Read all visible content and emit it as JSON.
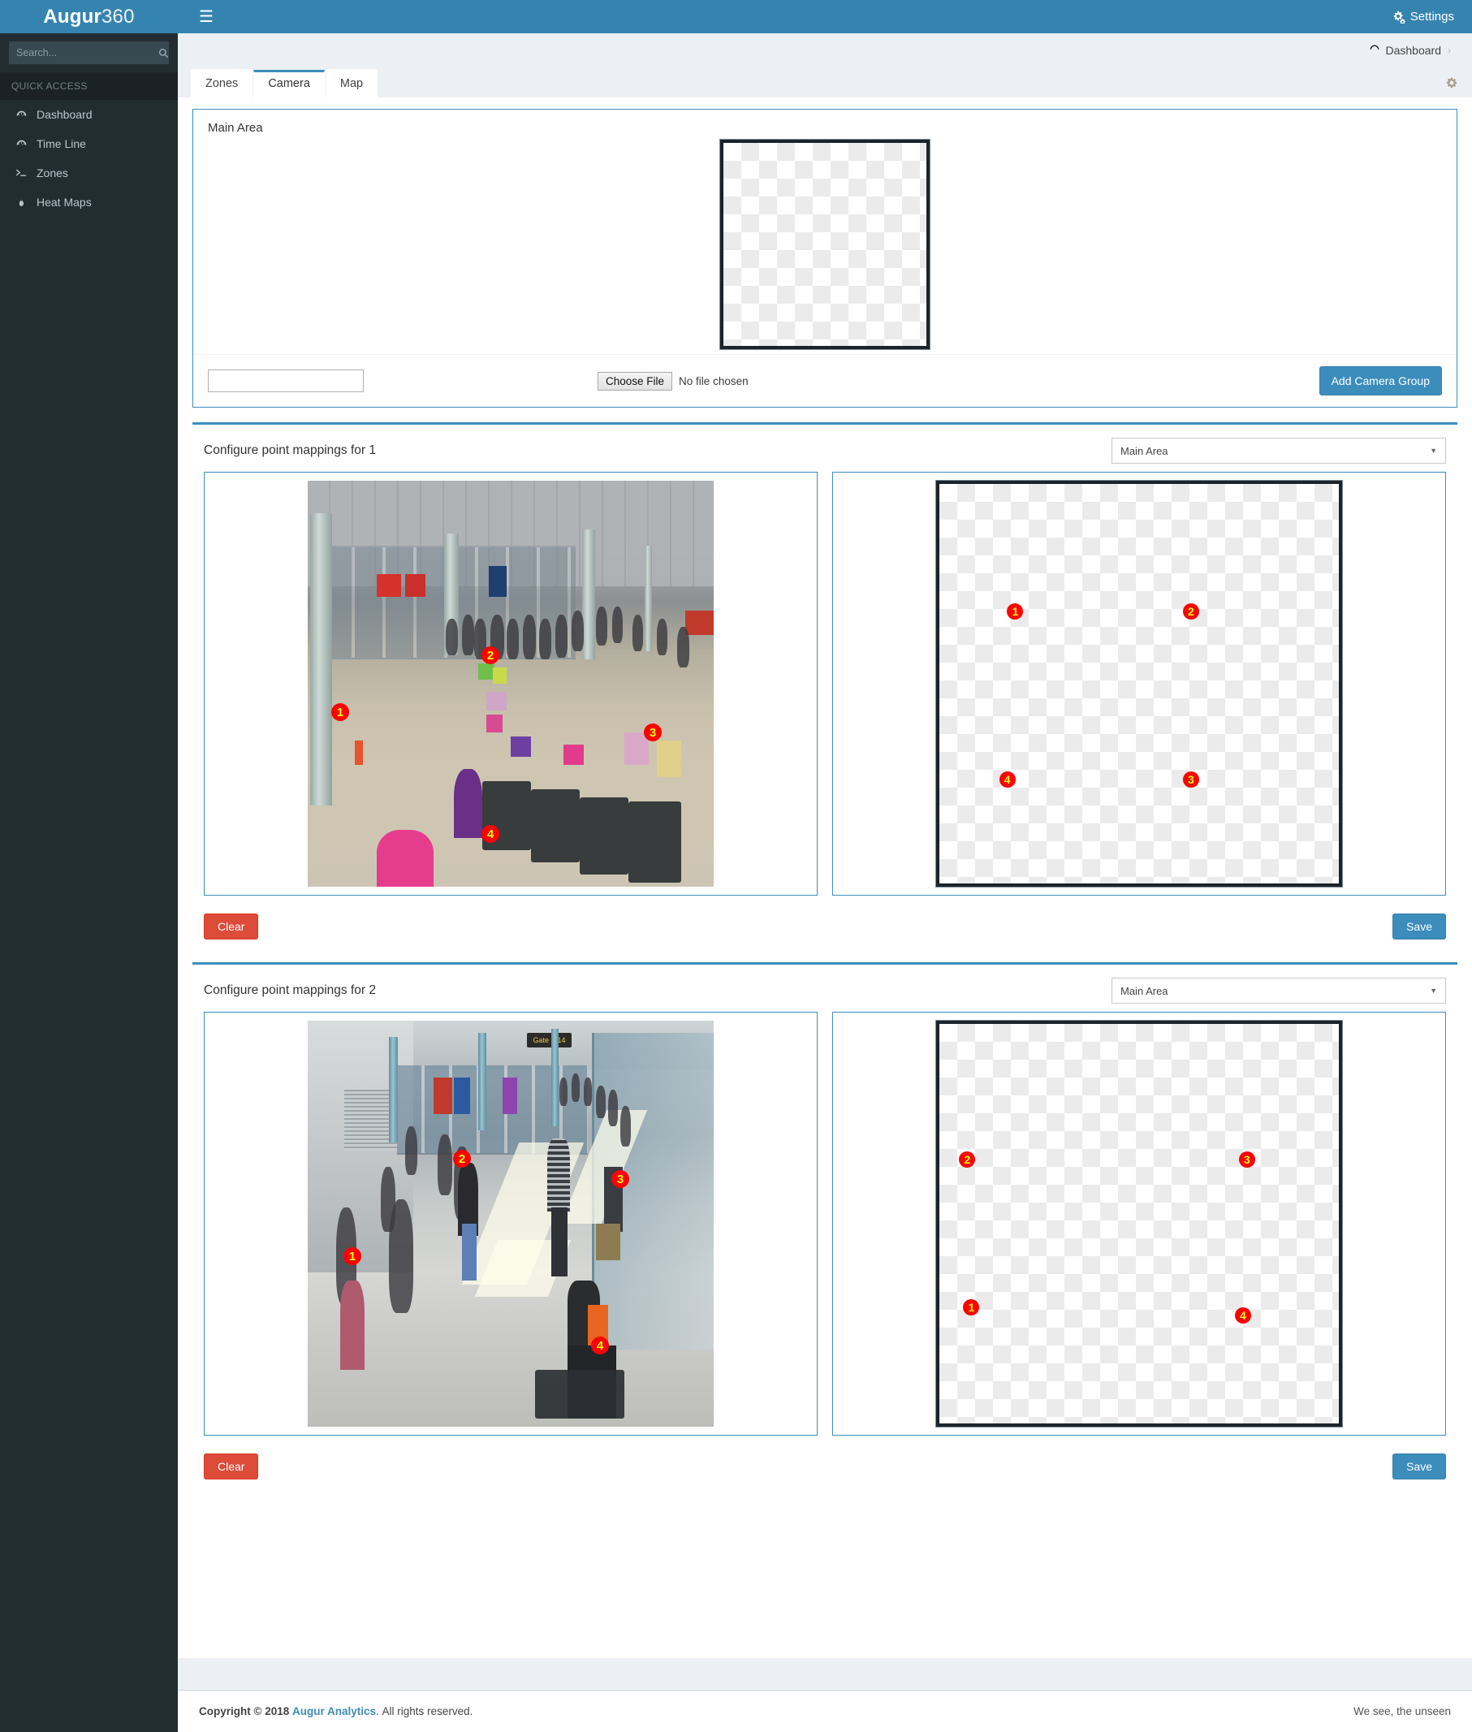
{
  "header": {
    "brand_bold": "Augur",
    "brand_light": "360",
    "menu_icon": "hamburger-icon",
    "settings_label": "Settings",
    "settings_icon": "gears-icon"
  },
  "sidebar": {
    "search_placeholder": "Search...",
    "search_value": "",
    "search_icon": "search-icon",
    "section_label": "QUICK ACCESS",
    "items": [
      {
        "label": "Dashboard",
        "icon": "dashboard-icon"
      },
      {
        "label": "Time Line",
        "icon": "timeline-icon"
      },
      {
        "label": "Zones",
        "icon": "terminal-icon"
      },
      {
        "label": "Heat Maps",
        "icon": "fire-icon"
      }
    ]
  },
  "breadcrumb": {
    "icon": "dashboard-icon",
    "label": "Dashboard",
    "separator": "›"
  },
  "tabs": [
    {
      "label": "Zones",
      "active": false
    },
    {
      "label": "Camera",
      "active": true
    },
    {
      "label": "Map",
      "active": false
    }
  ],
  "tabbar_gear_icon": "gear-icon",
  "camera_group_panel": {
    "title": "Main Area",
    "preview_alt": "transparent-checkerboard-placeholder",
    "name_input_value": "",
    "name_input_placeholder": "",
    "file_button_label": "Choose File",
    "file_status_label": "No file chosen",
    "add_button_label": "Add Camera Group"
  },
  "mappings": [
    {
      "title": "Configure point mappings for 1",
      "zone_selected": "Main Area",
      "zone_options": [
        "Main Area"
      ],
      "camera_scene": "airport-check-in-hall",
      "camera_points": [
        {
          "id": "1",
          "x": 8,
          "y": 57
        },
        {
          "id": "2",
          "x": 45,
          "y": 43
        },
        {
          "id": "3",
          "x": 85,
          "y": 62
        },
        {
          "id": "4",
          "x": 45,
          "y": 87
        }
      ],
      "map_points": [
        {
          "id": "1",
          "x": 19,
          "y": 32
        },
        {
          "id": "2",
          "x": 63,
          "y": 32
        },
        {
          "id": "4",
          "x": 17,
          "y": 74
        },
        {
          "id": "3",
          "x": 63,
          "y": 74
        }
      ],
      "clear_label": "Clear",
      "save_label": "Save"
    },
    {
      "title": "Configure point mappings for 2",
      "zone_selected": "Main Area",
      "zone_options": [
        "Main Area"
      ],
      "camera_scene": "airport-gate-corridor",
      "camera_sign_text": "Gate 8-14",
      "camera_points": [
        {
          "id": "1",
          "x": 11,
          "y": 58
        },
        {
          "id": "2",
          "x": 38,
          "y": 34
        },
        {
          "id": "3",
          "x": 77,
          "y": 39
        },
        {
          "id": "4",
          "x": 72,
          "y": 80
        }
      ],
      "map_points": [
        {
          "id": "2",
          "x": 7,
          "y": 34
        },
        {
          "id": "3",
          "x": 77,
          "y": 34
        },
        {
          "id": "1",
          "x": 8,
          "y": 71
        },
        {
          "id": "4",
          "x": 76,
          "y": 73
        }
      ],
      "clear_label": "Clear",
      "save_label": "Save"
    }
  ],
  "footer": {
    "copyright_prefix": "Copyright © 2018",
    "company": "Augur Analytics",
    "rights": "All rights reserved.",
    "tagline": "We see, the unseen"
  },
  "colors": {
    "header_blue": "#3584b0",
    "accent_blue": "#3c8dbc",
    "sidebar_dark": "#222d32",
    "content_bg": "#ecf0f5",
    "danger_red": "#dd4b39",
    "marker_red": "#fe0000",
    "marker_text": "#ffff00"
  }
}
